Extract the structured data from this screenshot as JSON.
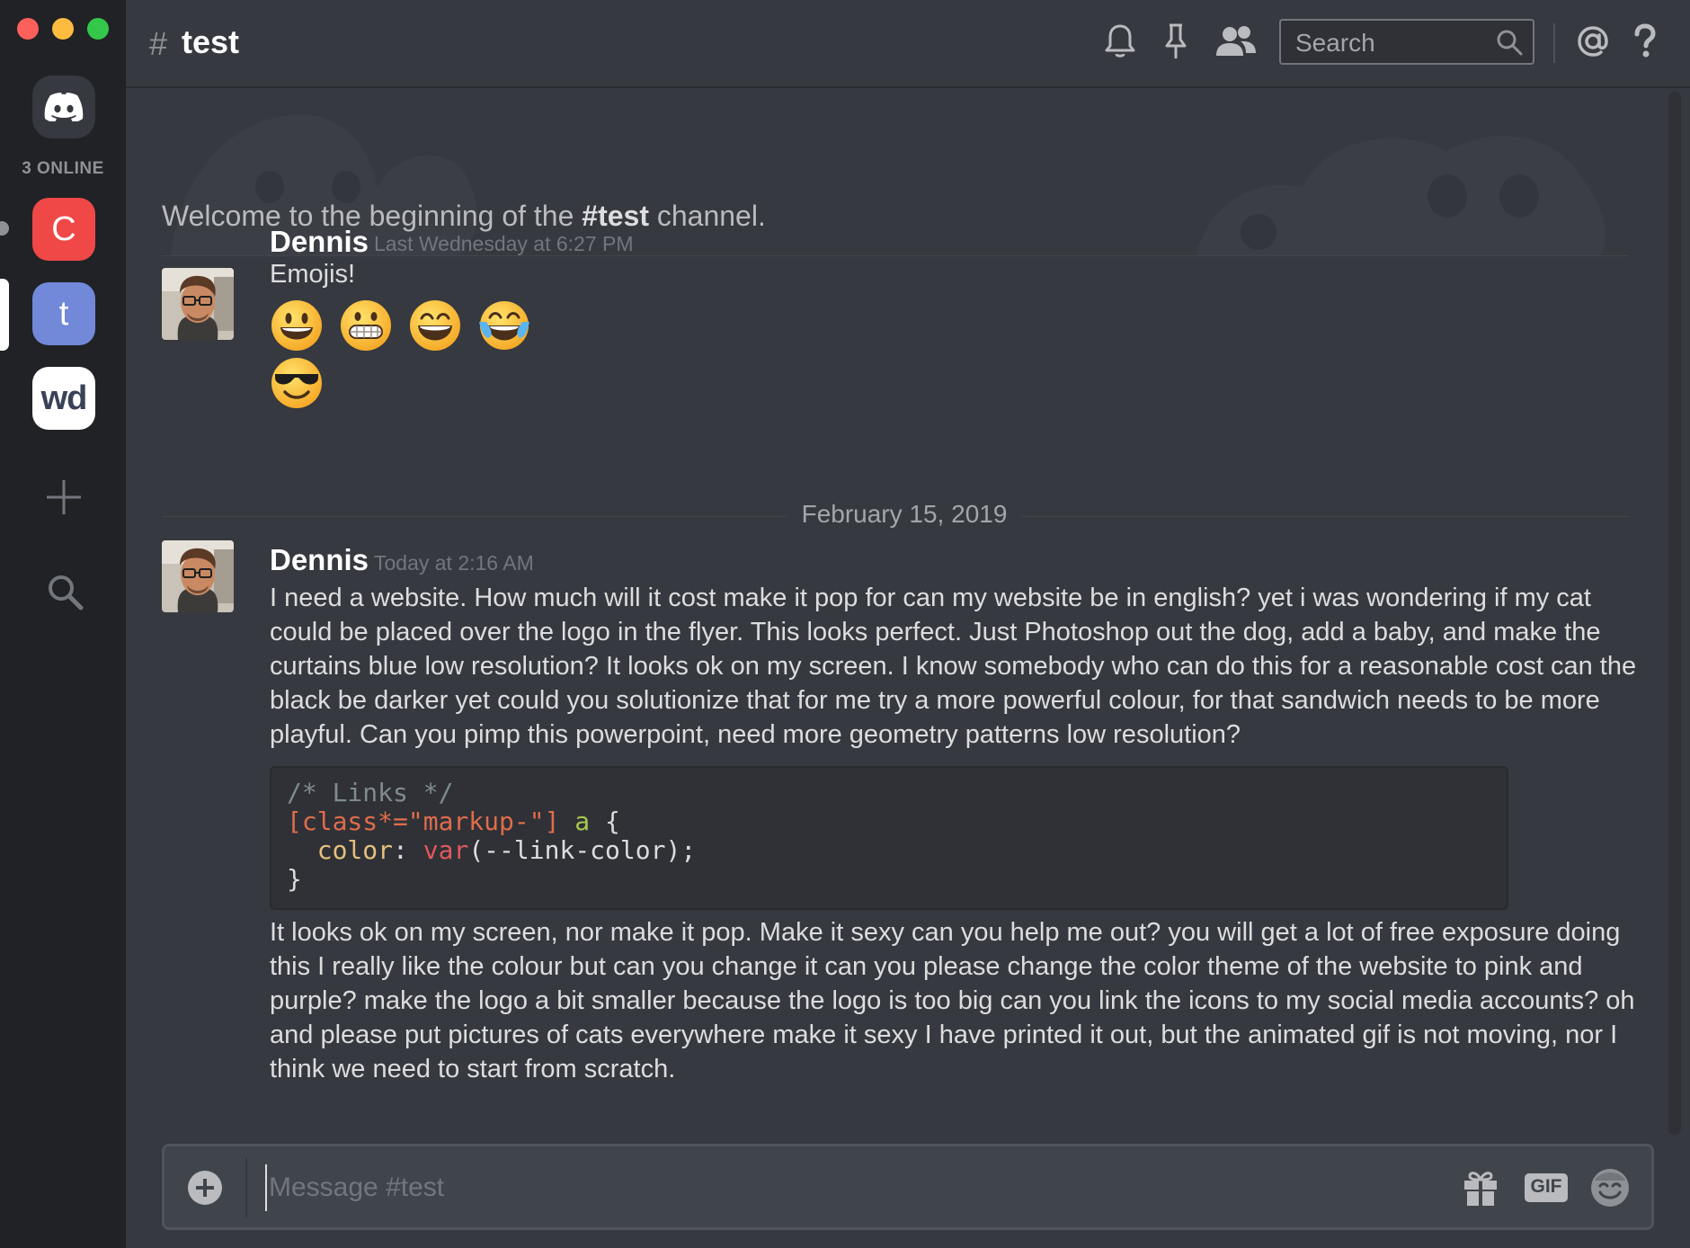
{
  "window": {
    "traffic_lights": [
      "close",
      "minimize",
      "zoom"
    ]
  },
  "rail": {
    "online_label": "3 ONLINE",
    "servers": [
      {
        "label": "C",
        "color": "#f04747"
      },
      {
        "label": "t",
        "color": "#7289da"
      },
      {
        "label": "wd",
        "color": "#ffffff"
      }
    ]
  },
  "header": {
    "hash": "#",
    "channel_name": "test",
    "search_placeholder": "Search",
    "icons": [
      "bell-icon",
      "pin-icon",
      "members-icon",
      "mention-icon",
      "help-icon"
    ]
  },
  "welcome": {
    "prefix": "Welcome to the beginning of the ",
    "channel": "#test",
    "suffix": " channel."
  },
  "messages": [
    {
      "author": "Dennis",
      "timestamp": "Last Wednesday at 6:27 PM",
      "text": "Emojis!",
      "emojis": [
        "grinning-face",
        "grimacing-face",
        "grinning-face-with-smiling-eyes",
        "face-with-tears-of-joy",
        "smiling-face-with-sunglasses"
      ]
    },
    {
      "author": "Dennis",
      "timestamp": "Today at 2:16 AM",
      "text_before": "I need a website. How much will it cost make it pop for can my website be in english? yet i was wondering if my cat could be placed over the logo in the flyer. This looks perfect. Just Photoshop out the dog, add a baby, and make the curtains blue low resolution? It looks ok on my screen. I know somebody who can do this for a reasonable cost can the black be darker yet could you solutionize that for me try a more powerful colour, for that sandwich needs to be more playful. Can you pimp this powerpoint, need more geometry patterns low resolution?",
      "code": {
        "comment": "/* Links */",
        "selector": "[class*=\"markup-\"]",
        "tag": "a",
        "open_brace": "{",
        "property": "color",
        "fn": "var",
        "arg": "(--link-color);",
        "close_brace": "}"
      },
      "text_after": "It looks ok on my screen, nor make it pop. Make it sexy can you help me out? you will get a lot of free exposure doing this I really like the colour but can you change it can you please change the color theme of the website to pink and purple? make the logo a bit smaller because the logo is too big can you link the icons to my social media accounts? oh and please put pictures of cats everywhere make it sexy I have printed it out, but the animated gif is not moving, nor I think we need to start from scratch."
    }
  ],
  "date_divider": "February 15, 2019",
  "composer": {
    "placeholder": "Message #test",
    "gif_label": "GIF"
  },
  "colors": {
    "background": "#36393f",
    "rail": "#202225",
    "accent": "#7289da"
  }
}
